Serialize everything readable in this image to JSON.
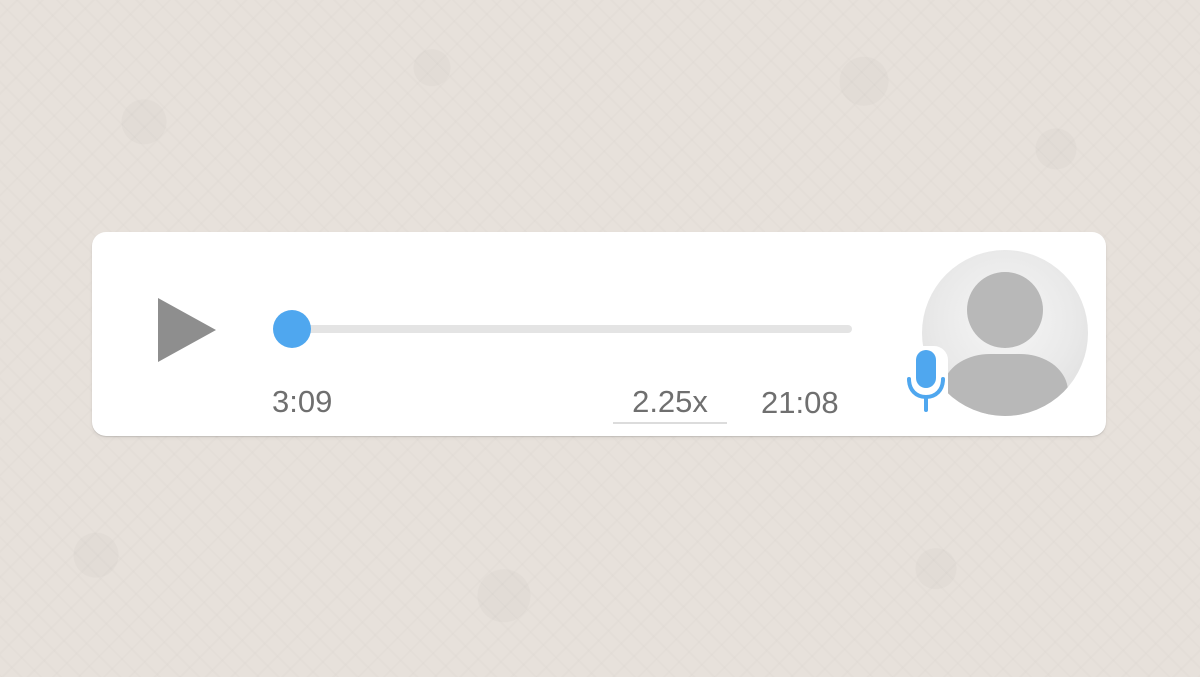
{
  "voice_message": {
    "elapsed": "3:09",
    "speed": "2.25x",
    "duration": "21:08",
    "progress": 0
  },
  "icons": {
    "play": "play-icon",
    "mic": "microphone-icon",
    "avatar": "default-avatar"
  },
  "colors": {
    "accent": "#4fa7ef",
    "bubble": "#ffffff",
    "background": "#e7e1db",
    "text": "#6f6f6f",
    "play_icon": "#8e8e8e",
    "track": "#e4e4e4"
  }
}
